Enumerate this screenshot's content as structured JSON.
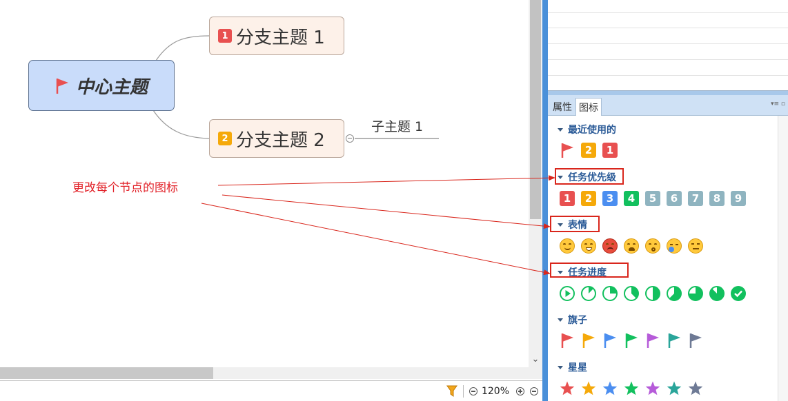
{
  "mindmap": {
    "central_topic": "中心主题",
    "branch_1": {
      "badge": "1",
      "label": "分支主题 1"
    },
    "branch_2": {
      "badge": "2",
      "label": "分支主题 2"
    },
    "subtopic_1": "子主题 1"
  },
  "annotation": "更改每个节点的图标",
  "statusbar": {
    "zoom": "120%"
  },
  "panel_tabs": [
    {
      "label": "属性",
      "selected": false
    },
    {
      "label": "图标",
      "selected": true
    }
  ],
  "icon_panel": {
    "recent": {
      "title": "最近使用的",
      "items": [
        "red-flag",
        "2",
        "1"
      ]
    },
    "priority": {
      "title": "任务优先级",
      "items": [
        "1",
        "2",
        "3",
        "4",
        "5",
        "6",
        "7",
        "8",
        "9"
      ]
    },
    "emotion": {
      "title": "表情",
      "items": [
        "smile-icon",
        "grin-icon",
        "angry-icon",
        "cry-icon",
        "shock-icon",
        "sleep-icon",
        "neutral-icon"
      ]
    },
    "progress": {
      "title": "任务进度",
      "items": [
        "start",
        "1/8",
        "2/8",
        "3/8",
        "4/8",
        "5/8",
        "6/8",
        "7/8",
        "done"
      ]
    },
    "flags": {
      "title": "旗子",
      "colors": [
        "#e85050",
        "#f5a90a",
        "#4b8ef0",
        "#12c05e",
        "#b65bd9",
        "#2aa59a",
        "#6e7a95"
      ]
    },
    "stars": {
      "title": "星星",
      "colors": [
        "#e85050",
        "#f5a90a",
        "#4b8ef0",
        "#12c05e",
        "#b65bd9",
        "#2aa59a",
        "#6e7a95"
      ]
    }
  },
  "colors": {
    "priority": [
      "#e85050",
      "#f5a90a",
      "#4b8ef0",
      "#12c05e",
      "#8fb4c0",
      "#8fb4c0",
      "#8fb4c0",
      "#8fb4c0",
      "#8fb4c0"
    ],
    "progress_green": "#12c05e",
    "highlight_red": "#d9261c"
  }
}
